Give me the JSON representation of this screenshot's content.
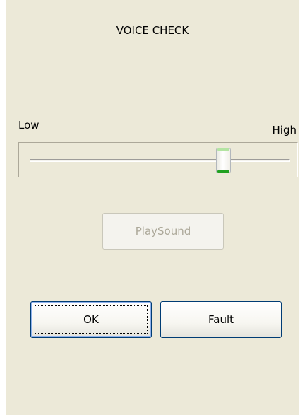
{
  "dialog": {
    "title": "VOICE CHECK"
  },
  "volume_slider": {
    "low_label": "Low",
    "high_label": "High",
    "value_fraction": 0.76
  },
  "buttons": {
    "play_sound_label": "PlaySound",
    "ok_label": "OK",
    "fault_label": "Fault"
  },
  "colors": {
    "dialog_background": "#ece9d8",
    "button_border": "#003c74",
    "thumb_accent": "#21a121"
  }
}
